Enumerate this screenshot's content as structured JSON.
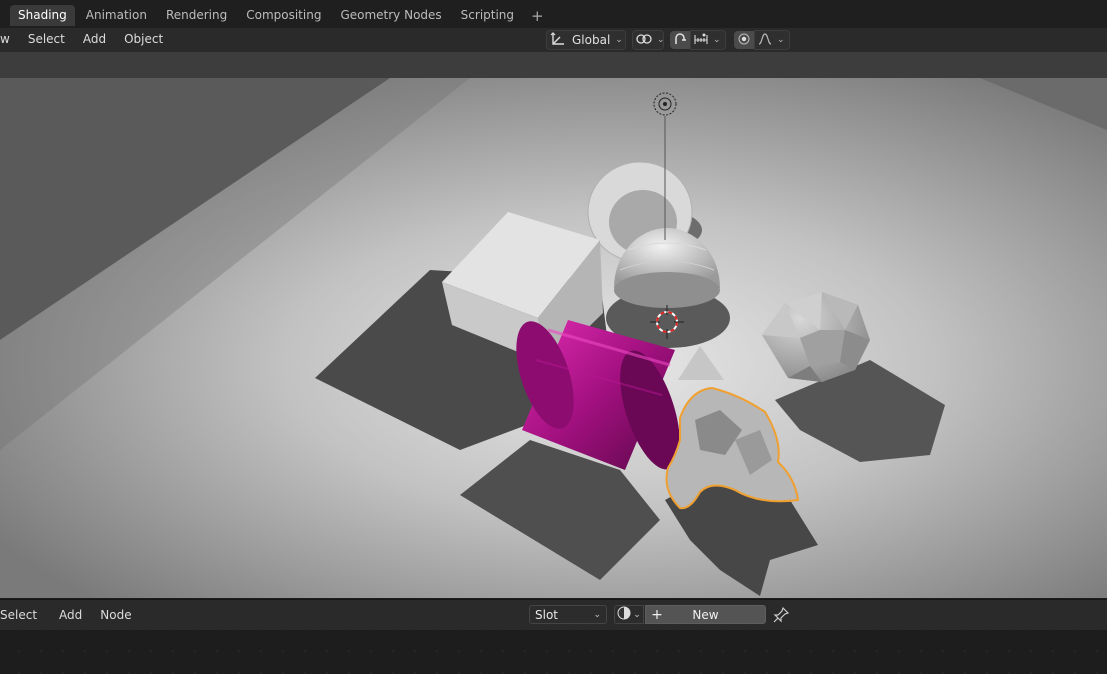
{
  "workspace_tabs": [
    {
      "label": "Shading",
      "active": true
    },
    {
      "label": "Animation",
      "active": false
    },
    {
      "label": "Rendering",
      "active": false
    },
    {
      "label": "Compositing",
      "active": false
    },
    {
      "label": "Geometry Nodes",
      "active": false
    },
    {
      "label": "Scripting",
      "active": false
    }
  ],
  "add_workspace_icon": "plus-icon",
  "viewport_header": {
    "view_partial": "w",
    "select": "Select",
    "add": "Add",
    "object": "Object",
    "transform_orientation": "Global",
    "icons": [
      "transform-orientation-icon",
      "pivot-icon",
      "snap-icon",
      "snap-increment-icon",
      "proportional-edit-icon",
      "falloff-icon"
    ]
  },
  "node_header": {
    "select": "Select",
    "add": "Add",
    "node": "Node",
    "slot_label": "Slot",
    "new_label": "New",
    "icons": [
      "material-browse-icon",
      "plus-icon",
      "pin-icon"
    ]
  },
  "colors": {
    "selection_outline": "#f0a030",
    "cylinder_material": "#c0159a",
    "active_tab": "#3a3a3a"
  },
  "scene_objects": [
    "cube",
    "torus",
    "uv-sphere-half",
    "icosphere",
    "cylinder",
    "cone",
    "suzanne-monkey",
    "light",
    "3d-cursor"
  ]
}
